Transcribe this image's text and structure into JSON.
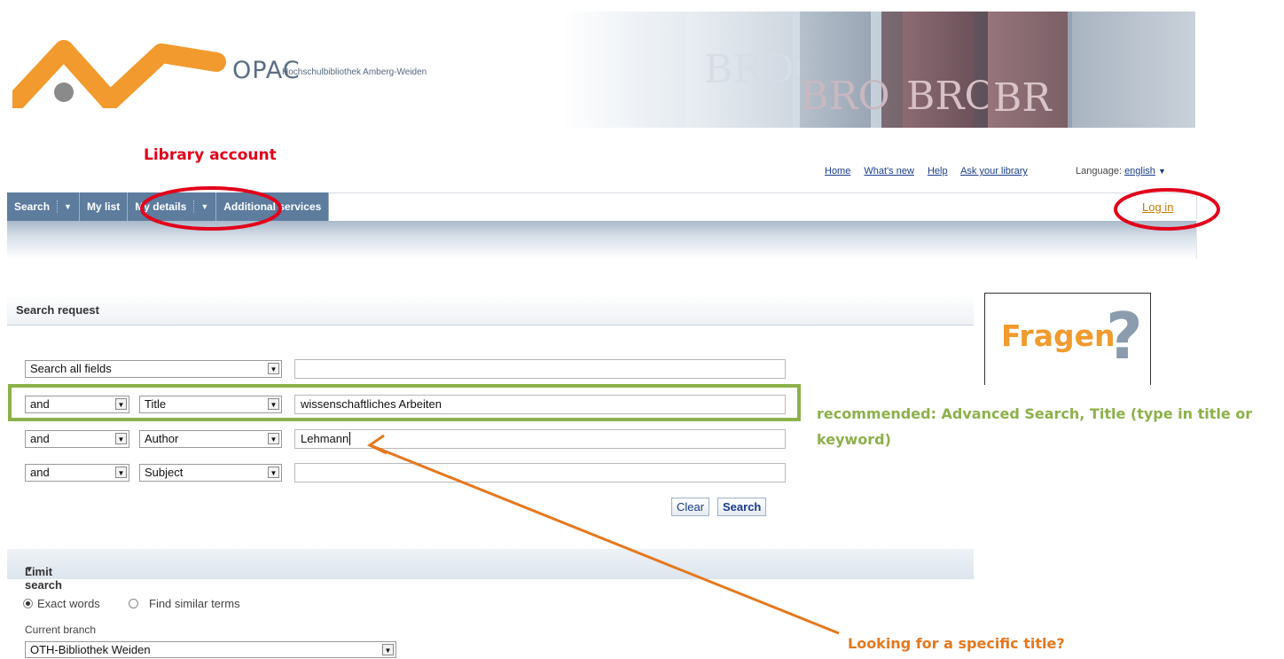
{
  "header": {
    "opac": "OPAC",
    "library_name": "Hochschulbibliothek Amberg-Weiden",
    "banner_texts": [
      "BROC",
      "BRO",
      "BRO",
      "BR"
    ]
  },
  "top_links": {
    "home": "Home",
    "whats_new": "What's new",
    "help": "Help",
    "ask_library": "Ask your library",
    "language_label": "Language:",
    "language_value": "english"
  },
  "nav": {
    "tabs": [
      {
        "label": "Search"
      },
      {
        "label": "My list"
      },
      {
        "label": "My details"
      },
      {
        "label": "Additional services"
      }
    ],
    "login": "Log in"
  },
  "annotations": {
    "library_account": "Library account",
    "recommended": "recommended: Advanced Search, Title (type in title or keyword)",
    "looking_for": "Looking for a specific title?"
  },
  "search": {
    "title": "Search request",
    "rows": [
      {
        "operator": "",
        "field": "Search all fields",
        "value": ""
      },
      {
        "operator": "and",
        "field": "Title",
        "value": "wissenschaftliches Arbeiten"
      },
      {
        "operator": "and",
        "field": "Author",
        "value": "Lehmann"
      },
      {
        "operator": "and",
        "field": "Subject",
        "value": ""
      }
    ],
    "clear_label": "Clear",
    "search_label": "Search"
  },
  "limit": {
    "title": "Limit search",
    "exact_words": "Exact words",
    "similar_terms": "Find similar terms",
    "branch_label": "Current branch",
    "branch_value": "OTH-Bibliothek Weiden"
  },
  "fragen": {
    "text": "Fragen",
    "mark": "?"
  },
  "colors": {
    "annotation_red": "#e2001a",
    "annotation_green": "#8cb14a",
    "annotation_orange": "#e5781e",
    "nav_blue": "#5d7c9e",
    "logo_orange": "#f29a2e"
  }
}
